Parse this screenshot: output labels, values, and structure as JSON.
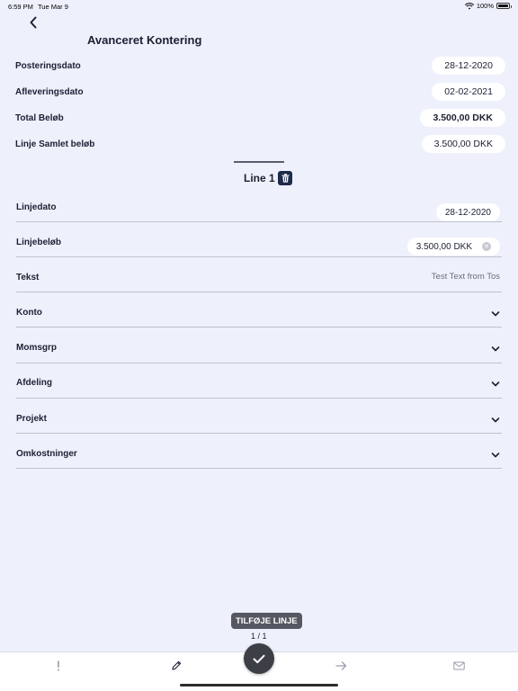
{
  "status": {
    "time": "6:59 PM",
    "date": "Tue Mar 9",
    "battery": "100%"
  },
  "page": {
    "title": "Avanceret Kontering"
  },
  "header_fields": [
    {
      "label": "Posteringsdato",
      "value": "28-12-2020",
      "bold": false
    },
    {
      "label": "Afleveringsdato",
      "value": "02-02-2021",
      "bold": false
    },
    {
      "label": "Total Beløb",
      "value": "3.500,00 DKK",
      "bold": true
    },
    {
      "label": "Linje Samlet beløb",
      "value": "3.500,00 DKK",
      "bold": false
    }
  ],
  "line": {
    "title": "Line 1"
  },
  "line_fields": [
    {
      "label": "Linjedato",
      "value": "28-12-2020",
      "type": "date-pill"
    },
    {
      "label": "Linjebeløb",
      "value": "3.500,00 DKK",
      "type": "amount-pill"
    },
    {
      "label": "Tekst",
      "value": "Test Text from Tos",
      "type": "text"
    },
    {
      "label": "Konto",
      "type": "dropdown"
    },
    {
      "label": "Momsgrp",
      "type": "dropdown"
    },
    {
      "label": "Afdeling",
      "type": "dropdown"
    },
    {
      "label": "Projekt",
      "type": "dropdown"
    },
    {
      "label": "Omkostninger",
      "type": "dropdown"
    }
  ],
  "actions": {
    "add_line": "TILFØJE LINJE",
    "pager": "1 / 1"
  },
  "tabbar": {
    "icons": [
      "exclamation-icon",
      "pencil-icon",
      "checkmark-icon",
      "arrow-right-icon",
      "mail-icon"
    ]
  },
  "colors": {
    "background": "#eef0fc",
    "accent_dark": "#1d2a4a",
    "fab": "#3d3f46"
  }
}
